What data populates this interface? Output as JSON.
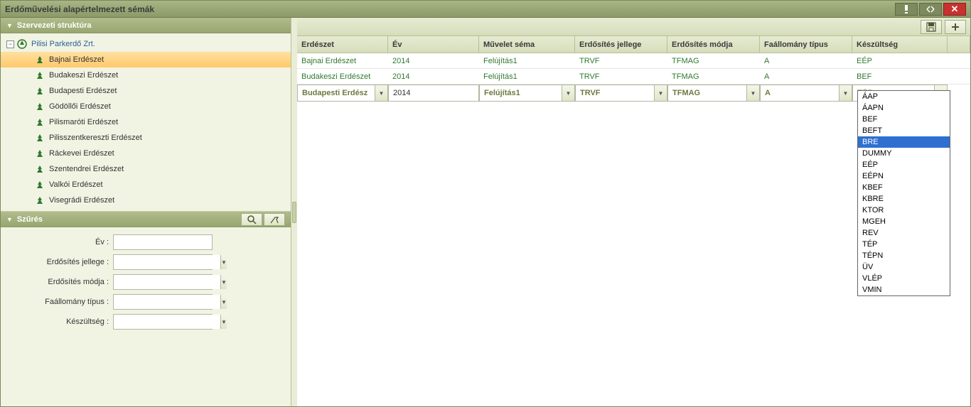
{
  "window": {
    "title": "Erdőművelési alapértelmezett sémák"
  },
  "sidebar": {
    "tree_title": "Szervezeti struktúra",
    "root": "Pilisi Parkerdő Zrt.",
    "items": [
      "Bajnai Erdészet",
      "Budakeszi Erdészet",
      "Budapesti Erdészet",
      "Gödöllői Erdészet",
      "Pilismaróti Erdészet",
      "Pilisszentkereszti Erdészet",
      "Ráckevei Erdészet",
      "Szentendrei Erdészet",
      "Valkói Erdészet",
      "Visegrádi Erdészet"
    ],
    "selected_index": 0
  },
  "filter": {
    "title": "Szűrés",
    "labels": {
      "ev": "Év :",
      "jelleg": "Erdősítés jellege :",
      "modja": "Erdősítés módja :",
      "tipus": "Faállomány típus :",
      "keszultseg": "Készültség :"
    },
    "values": {
      "ev": "",
      "jelleg": "",
      "modja": "",
      "tipus": "",
      "keszultseg": ""
    }
  },
  "grid": {
    "headers": [
      "Erdészet",
      "Év",
      "Művelet séma",
      "Erdősítés jellege",
      "Erdősítés módja",
      "Faállomány típus",
      "Készültség"
    ],
    "rows": [
      [
        "Bajnai Erdészet",
        "2014",
        "Felújítás1",
        "TRVF",
        "TFMAG",
        "A",
        "EÉP"
      ],
      [
        "Budakeszi Erdészet",
        "2014",
        "Felújítás1",
        "TRVF",
        "TFMAG",
        "A",
        "BEF"
      ]
    ],
    "edit_row": {
      "erdeszet": "Budapesti Erdész",
      "ev": "2014",
      "sema": "Felújítás1",
      "jelleg": "TRVF",
      "modja": "TFMAG",
      "tipus": "A",
      "keszultseg": "EÉP"
    }
  },
  "dropdown": {
    "options": [
      "ÁAP",
      "ÁAPN",
      "BEF",
      "BEFT",
      "BRE",
      "DUMMY",
      "EÉP",
      "EÉPN",
      "KBEF",
      "KBRE",
      "KTOR",
      "MGEH",
      "REV",
      "TÉP",
      "TÉPN",
      "ÜV",
      "VLÉP",
      "VMIN"
    ],
    "highlight_index": 4
  }
}
